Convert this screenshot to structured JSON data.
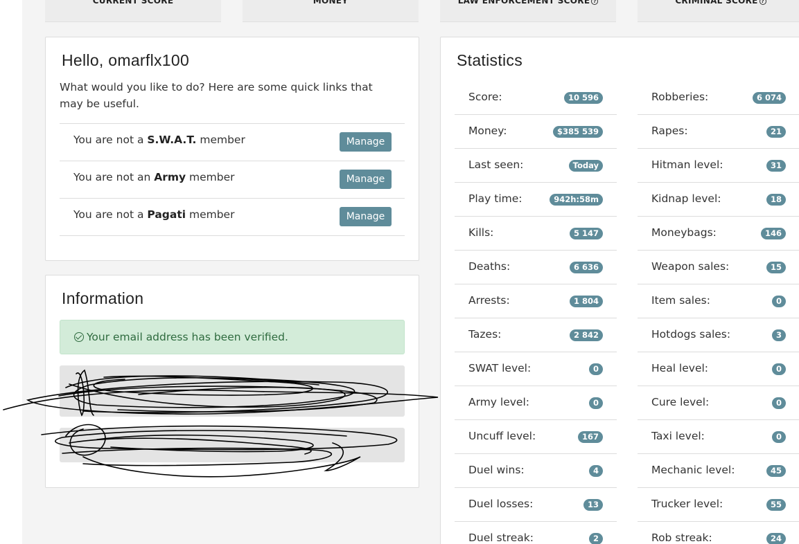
{
  "top_cards": [
    {
      "label": "CURRENT SCORE",
      "help": false
    },
    {
      "label": "MONEY",
      "help": false
    },
    {
      "label": "LAW ENFORCEMENT SCORE",
      "help": true
    },
    {
      "label": "CRIMINAL SCORE",
      "help": true
    }
  ],
  "welcome": {
    "title": "Hello, omarflx100",
    "intro": "What would you like to do? Here are some quick links that may be useful.",
    "members": [
      {
        "prefix": "You are not a ",
        "org": "S.W.A.T.",
        "suffix": " member",
        "button": "Manage"
      },
      {
        "prefix": "You are not an ",
        "org": "Army",
        "suffix": " member",
        "button": "Manage"
      },
      {
        "prefix": "You are not a ",
        "org": "Pagati",
        "suffix": " member",
        "button": "Manage"
      }
    ]
  },
  "information": {
    "title": "Information",
    "alert": "Your email address has been verified."
  },
  "statistics": {
    "title": "Statistics",
    "left": [
      {
        "label": "Score:",
        "value": "10 596"
      },
      {
        "label": "Money:",
        "value": "$385 539"
      },
      {
        "label": "Last seen:",
        "value": "Today"
      },
      {
        "label": "Play time:",
        "value": "942h:58m"
      },
      {
        "label": "Kills:",
        "value": "5 147"
      },
      {
        "label": "Deaths:",
        "value": "6 636"
      },
      {
        "label": "Arrests:",
        "value": "1 804"
      },
      {
        "label": "Tazes:",
        "value": "2 842"
      },
      {
        "label": "SWAT level:",
        "value": "0"
      },
      {
        "label": "Army level:",
        "value": "0"
      },
      {
        "label": "Uncuff level:",
        "value": "167"
      },
      {
        "label": "Duel wins:",
        "value": "4"
      },
      {
        "label": "Duel losses:",
        "value": "13"
      },
      {
        "label": "Duel streak:",
        "value": "2"
      }
    ],
    "right": [
      {
        "label": "Robberies:",
        "value": "6 074"
      },
      {
        "label": "Rapes:",
        "value": "21"
      },
      {
        "label": "Hitman level:",
        "value": "31"
      },
      {
        "label": "Kidnap level:",
        "value": "18"
      },
      {
        "label": "Moneybags:",
        "value": "146"
      },
      {
        "label": "Weapon sales:",
        "value": "15"
      },
      {
        "label": "Item sales:",
        "value": "0"
      },
      {
        "label": "Hotdogs sales:",
        "value": "3"
      },
      {
        "label": "Heal level:",
        "value": "0"
      },
      {
        "label": "Cure level:",
        "value": "0"
      },
      {
        "label": "Taxi level:",
        "value": "0"
      },
      {
        "label": "Mechanic level:",
        "value": "45"
      },
      {
        "label": "Trucker level:",
        "value": "55"
      },
      {
        "label": "Rob streak:",
        "value": "24"
      }
    ]
  },
  "colors": {
    "accent": "#5f8c9a",
    "success_bg": "#d3ecd9",
    "success_text": "#2f6b3f"
  }
}
